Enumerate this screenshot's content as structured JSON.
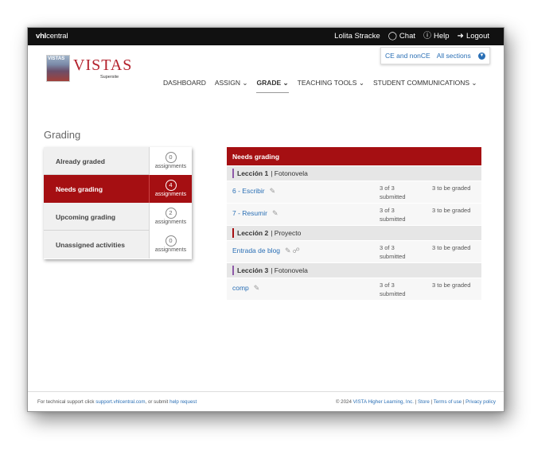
{
  "topbar": {
    "brand_bold": "vhl",
    "brand_rest": "central",
    "user_name": "Lolita Stracke",
    "chat_label": "Chat",
    "help_label": "Help",
    "logout_label": "Logout"
  },
  "logo": {
    "tag": "VISTAS",
    "word": "VISTAS",
    "sub": "Supersite"
  },
  "sections": {
    "course": "CE and nonCE",
    "section": "All sections"
  },
  "nav": [
    "DASHBOARD",
    "ASSIGN",
    "GRADE",
    "TEACHING TOOLS",
    "STUDENT COMMUNICATIONS"
  ],
  "page_title": "Grading",
  "left_panel": [
    {
      "label": "Already graded",
      "count": "0",
      "unit": "assignments"
    },
    {
      "label": "Needs grading",
      "count": "4",
      "unit": "assignments"
    },
    {
      "label": "Upcoming grading",
      "count": "2",
      "unit": "assignments"
    },
    {
      "label": "Unassigned activities",
      "count": "0",
      "unit": "assignments"
    }
  ],
  "right_panel": {
    "header": "Needs grading",
    "lessons": [
      {
        "title": "Lección 1",
        "type": "Fotonovela",
        "color": "#8e5aa8",
        "items": [
          {
            "name": "6 - Escribir",
            "submitted_a": "3 of 3",
            "submitted_b": "submitted",
            "to_grade": "3 to be graded"
          },
          {
            "name": "7 - Resumir",
            "submitted_a": "3 of 3",
            "submitted_b": "submitted",
            "to_grade": "3 to be graded"
          }
        ]
      },
      {
        "title": "Lección 2",
        "type": "Proyecto",
        "color": "#a50f12",
        "items": [
          {
            "name": "Entrada de blog",
            "submitted_a": "3 of 3",
            "submitted_b": "submitted",
            "to_grade": "3 to be graded"
          }
        ]
      },
      {
        "title": "Lección 3",
        "type": "Fotonovela",
        "color": "#8e5aa8",
        "items": [
          {
            "name": "comp",
            "submitted_a": "3 of 3",
            "submitted_b": "submitted",
            "to_grade": "3 to be graded"
          }
        ]
      }
    ]
  },
  "footer": {
    "left_text": "For technical support click",
    "support_link": "support.vhlcentral.com",
    "left_mid": ", or submit",
    "help_link": "help request",
    "copyright": "© 2024",
    "company_link": "VISTA Higher Learning, Inc.",
    "store": "Store",
    "terms": "Terms of use",
    "privacy": "Privacy policy"
  }
}
